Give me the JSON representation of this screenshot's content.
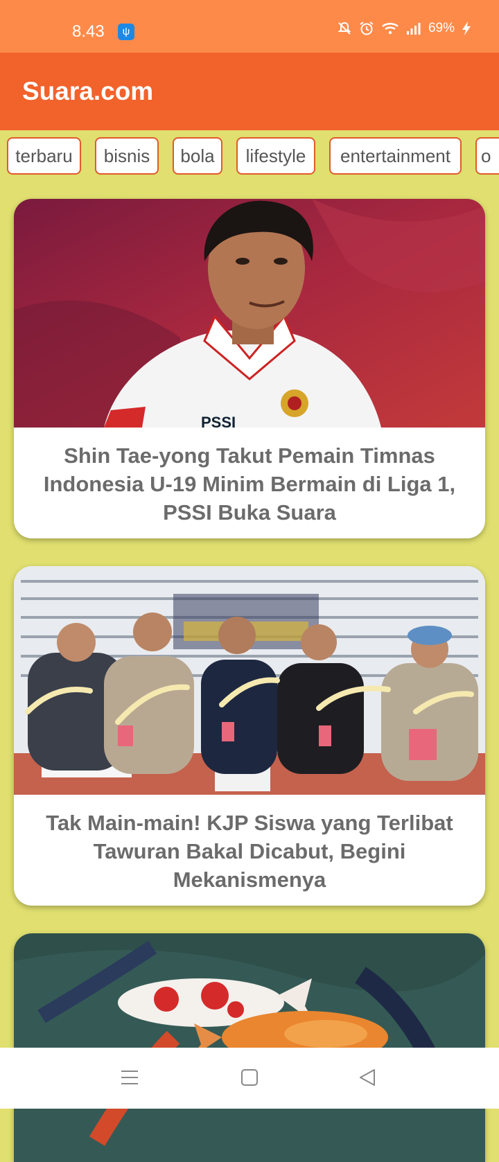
{
  "status_bar": {
    "time": "8.43",
    "battery": "69%",
    "icons": [
      "usb-icon",
      "mute-icon",
      "alarm-icon",
      "wifi-icon",
      "signal-icon",
      "battery-icon",
      "charging-icon"
    ]
  },
  "app_bar": {
    "title": "Suara.com"
  },
  "categories": [
    "terbaru",
    "bisnis",
    "bola",
    "lifestyle",
    "entertainment",
    "o"
  ],
  "articles": [
    {
      "title": "Shin Tae-yong Takut Pemain Timnas Indonesia U-19 Minim Bermain di Liga 1, PSSI Buka Suara",
      "image": "man-in-white-polo-photo"
    },
    {
      "title": "Tak Main-main! KJP Siswa yang Terlibat Tawuran Bakal Dicabut, Begini Mekanismenya",
      "image": "police-press-conference-photo"
    },
    {
      "title": "",
      "image": "koi-fish-photo"
    }
  ],
  "nav_bar": {
    "icons": [
      "menu-icon",
      "home-square-icon",
      "back-triangle-icon"
    ]
  },
  "colors": {
    "status_bar": "#fe8a4a",
    "app_bar": "#f2622b",
    "background": "#e0df6f",
    "chip_border": "#e15a2b"
  }
}
